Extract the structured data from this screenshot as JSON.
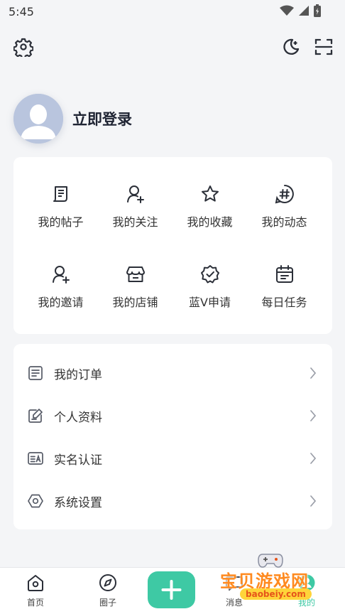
{
  "status_bar": {
    "time": "5:45"
  },
  "profile": {
    "login_label": "立即登录"
  },
  "grid": [
    {
      "label": "我的帖子",
      "icon": "post-icon"
    },
    {
      "label": "我的关注",
      "icon": "follow-icon"
    },
    {
      "label": "我的收藏",
      "icon": "star-icon"
    },
    {
      "label": "我的动态",
      "icon": "hashtag-icon"
    },
    {
      "label": "我的邀请",
      "icon": "invite-icon"
    },
    {
      "label": "我的店铺",
      "icon": "store-icon"
    },
    {
      "label": "蓝V申请",
      "icon": "verified-badge-icon"
    },
    {
      "label": "每日任务",
      "icon": "calendar-icon"
    }
  ],
  "list": [
    {
      "label": "我的订单",
      "icon": "order-icon"
    },
    {
      "label": "个人资料",
      "icon": "edit-profile-icon"
    },
    {
      "label": "实名认证",
      "icon": "id-card-icon"
    },
    {
      "label": "系统设置",
      "icon": "hexagon-settings-icon"
    }
  ],
  "bottom_nav": [
    {
      "label": "首页",
      "icon": "home-icon"
    },
    {
      "label": "圈子",
      "icon": "compass-icon"
    },
    {
      "label": "消息",
      "icon": "message-icon"
    },
    {
      "label": "我的",
      "icon": "profile-icon"
    }
  ],
  "watermark": {
    "title": "宝贝游戏网",
    "url": "baobeiy.com"
  },
  "colors": {
    "accent": "#3ec9a4",
    "background": "#f4f5f7",
    "card": "#ffffff"
  }
}
